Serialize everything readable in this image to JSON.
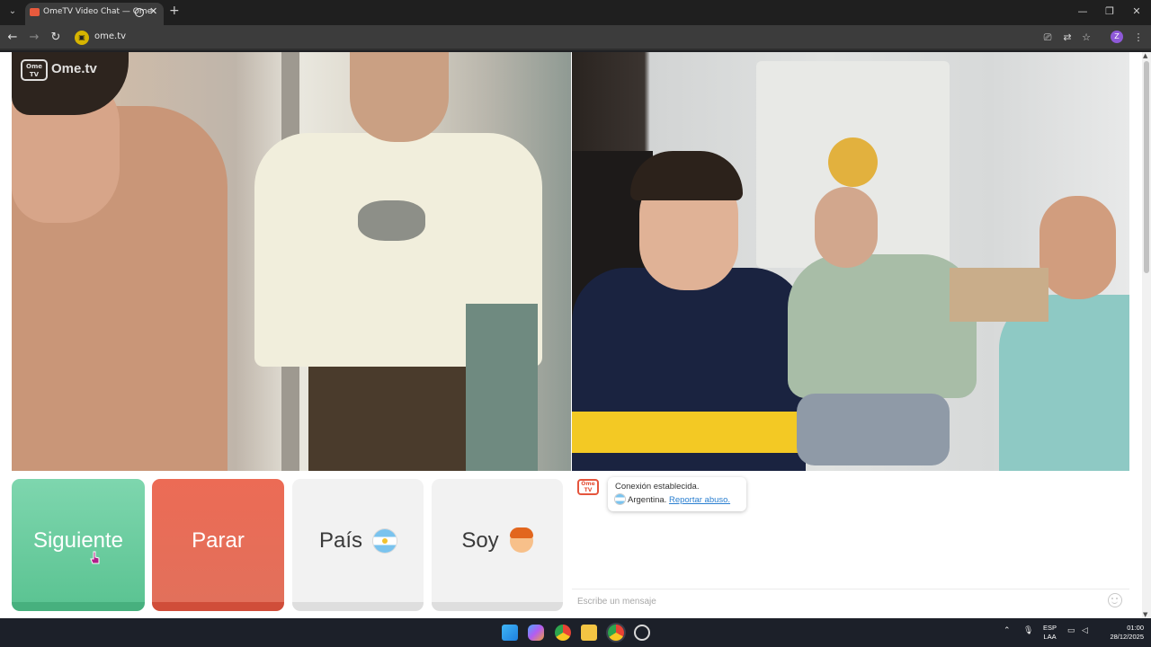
{
  "browser": {
    "tab_title": "OmeTV Video Chat — Ome",
    "tab_close": "✕",
    "new_tab": "+",
    "url": "ome.tv",
    "profile_initial": "Z",
    "window": {
      "minimize": "—",
      "maximize": "❐",
      "close": "✕"
    }
  },
  "brand": {
    "logo_word": "Ome.tv",
    "logo_tv": "Ome TV",
    "accent": "#e5553d"
  },
  "buttons": {
    "next": "Siguiente",
    "stop": "Parar",
    "country": "País",
    "gender": "Soy"
  },
  "chat": {
    "status": "Conexión establecida.",
    "country": "Argentina.",
    "report_link": "Reportar abuso.",
    "placeholder": "Escribe un mensaje"
  },
  "taskbar": {
    "lang_line1": "ESP",
    "lang_line2": "LAA",
    "time": "01:00",
    "date": "28/12/2025",
    "icons": [
      "start-icon",
      "copilot-icon",
      "chrome-icon",
      "file-explorer-icon",
      "chrome-profile-icon",
      "settings-icon"
    ]
  },
  "colors": {
    "next_button": "#5cc493",
    "stop_button": "#e2705b",
    "neutral_button": "#f2f2f2",
    "link": "#2a7fd0"
  }
}
